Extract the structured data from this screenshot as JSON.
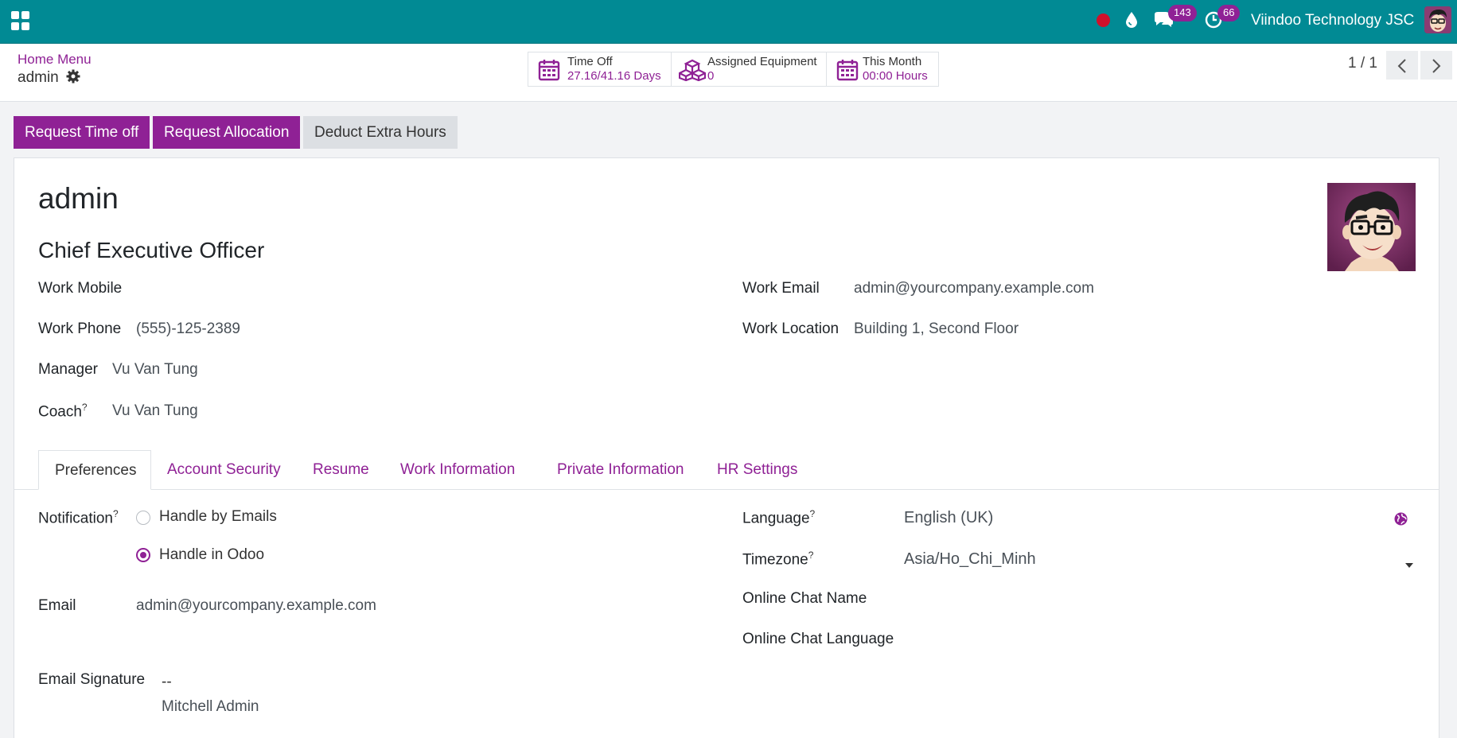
{
  "navbar": {
    "company": "Viindoo Technology JSC",
    "messages_count": "143",
    "activities_count": "66",
    "colors": {
      "background": "#018a94",
      "badge": "#8f2195",
      "recording": "#d0112b"
    }
  },
  "breadcrumb": {
    "parent": "Home Menu",
    "current": "admin"
  },
  "smart_buttons": [
    {
      "label": "Time Off",
      "value": "27.16/41.16 Days",
      "icon": "calendar-icon"
    },
    {
      "label": "Assigned Equipment",
      "value": "0",
      "icon": "cubes-icon"
    },
    {
      "label": "This Month",
      "value": "00:00 Hours",
      "icon": "calendar-icon"
    }
  ],
  "pager": {
    "value": "1 / 1"
  },
  "actions": {
    "request_time_off": "Request Time off",
    "request_allocation": "Request Allocation",
    "deduct_extra_hours": "Deduct Extra Hours"
  },
  "employee": {
    "name": "admin",
    "job_title": "Chief Executive Officer",
    "fields": {
      "work_mobile_label": "Work Mobile",
      "work_mobile": "",
      "work_phone_label": "Work Phone",
      "work_phone": "(555)-125-2389",
      "manager_label": "Manager",
      "manager": "Vu Van Tung",
      "coach_label": "Coach",
      "coach": "Vu Van Tung",
      "work_email_label": "Work Email",
      "work_email": "admin@yourcompany.example.com",
      "work_location_label": "Work Location",
      "work_location": "Building 1, Second Floor"
    }
  },
  "tabs": [
    "Preferences",
    "Account Security",
    "Resume",
    "Work Information",
    "Private Information",
    "HR Settings"
  ],
  "preferences": {
    "notification_label": "Notification",
    "notification_options": [
      "Handle by Emails",
      "Handle in Odoo"
    ],
    "notification_selected": "Handle in Odoo",
    "email_label": "Email",
    "email": "admin@yourcompany.example.com",
    "signature_label": "Email Signature",
    "signature_line1": "--",
    "signature_line2": "Mitchell Admin",
    "language_label": "Language",
    "language": "English (UK)",
    "timezone_label": "Timezone",
    "timezone": "Asia/Ho_Chi_Minh",
    "chat_name_label": "Online Chat Name",
    "chat_language_label": "Online Chat Language"
  },
  "help_mark": "?"
}
